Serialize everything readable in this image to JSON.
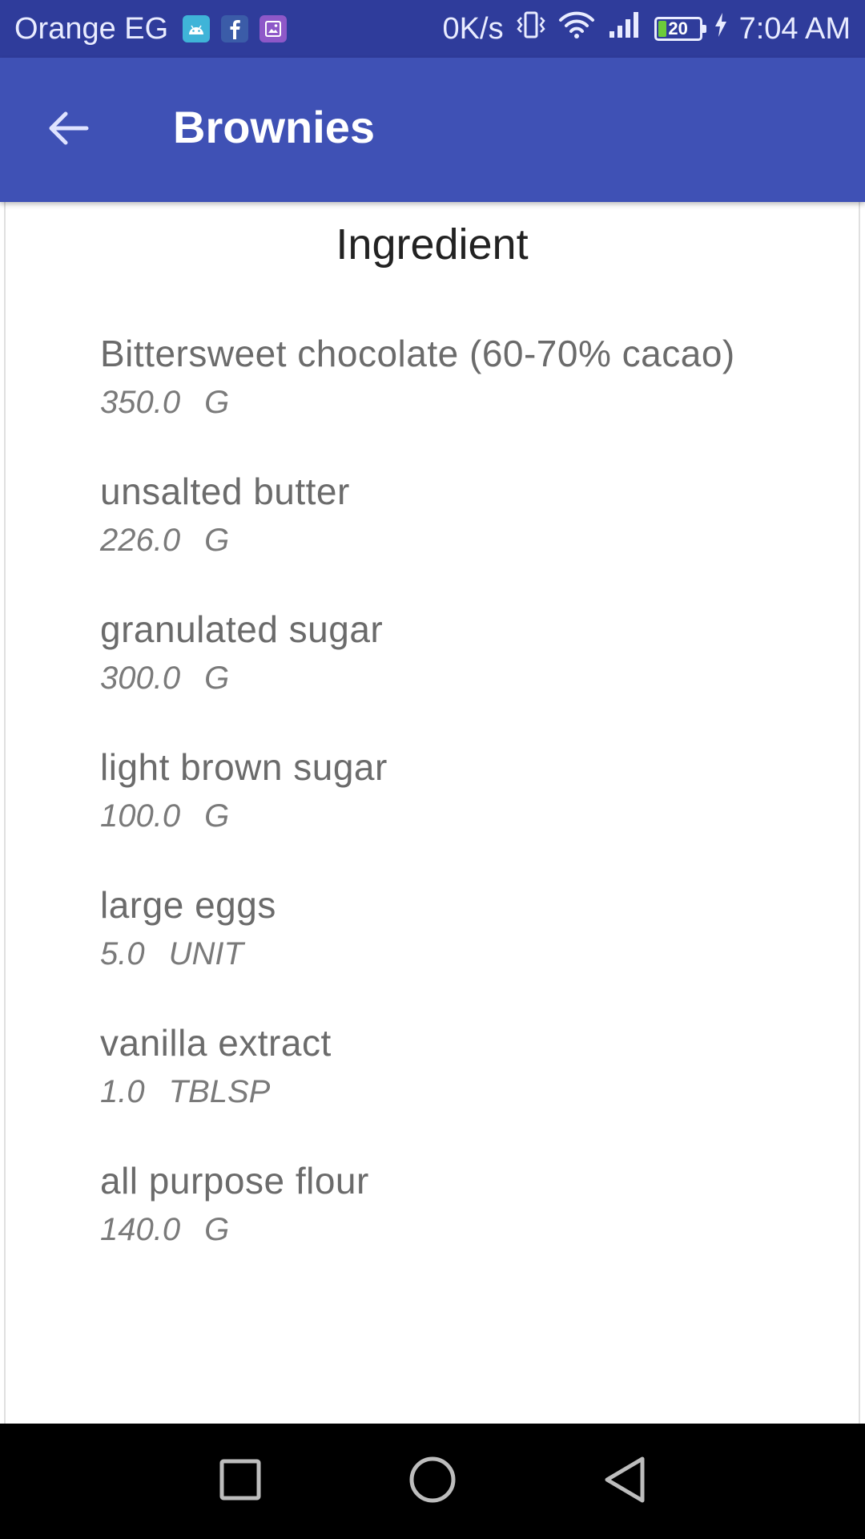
{
  "status_bar": {
    "carrier": "Orange EG",
    "net_speed": "0K/s",
    "battery_level": "20",
    "battery_fraction": 0.2,
    "time": "7:04 AM",
    "notification_icons": [
      "android-icon",
      "facebook-icon",
      "gallery-icon"
    ],
    "status_icons": [
      "vibrate-icon",
      "wifi-icon",
      "signal-icon",
      "battery-icon",
      "charging-icon"
    ]
  },
  "app_bar": {
    "title": "Brownies",
    "back_icon": "arrow-back-icon"
  },
  "content": {
    "section_title": "Ingredient",
    "ingredients": [
      {
        "name": "Bittersweet chocolate (60-70% cacao)",
        "amount": "350.0",
        "unit": "G"
      },
      {
        "name": "unsalted butter",
        "amount": "226.0",
        "unit": "G"
      },
      {
        "name": "granulated sugar",
        "amount": "300.0",
        "unit": "G"
      },
      {
        "name": "light brown sugar",
        "amount": "100.0",
        "unit": "G"
      },
      {
        "name": "large eggs",
        "amount": "5.0",
        "unit": "UNIT"
      },
      {
        "name": "vanilla extract",
        "amount": "1.0",
        "unit": "TBLSP"
      },
      {
        "name": "all purpose flour",
        "amount": "140.0",
        "unit": "G"
      }
    ]
  },
  "nav_bar": {
    "buttons": [
      "recent-apps-icon",
      "home-icon",
      "back-triangle-icon"
    ]
  },
  "colors": {
    "status_bar": "#2f3c9b",
    "app_bar": "#3f51b5",
    "text_primary": "#222222",
    "text_secondary": "#6b6b6b",
    "nav_bar": "#000000"
  }
}
